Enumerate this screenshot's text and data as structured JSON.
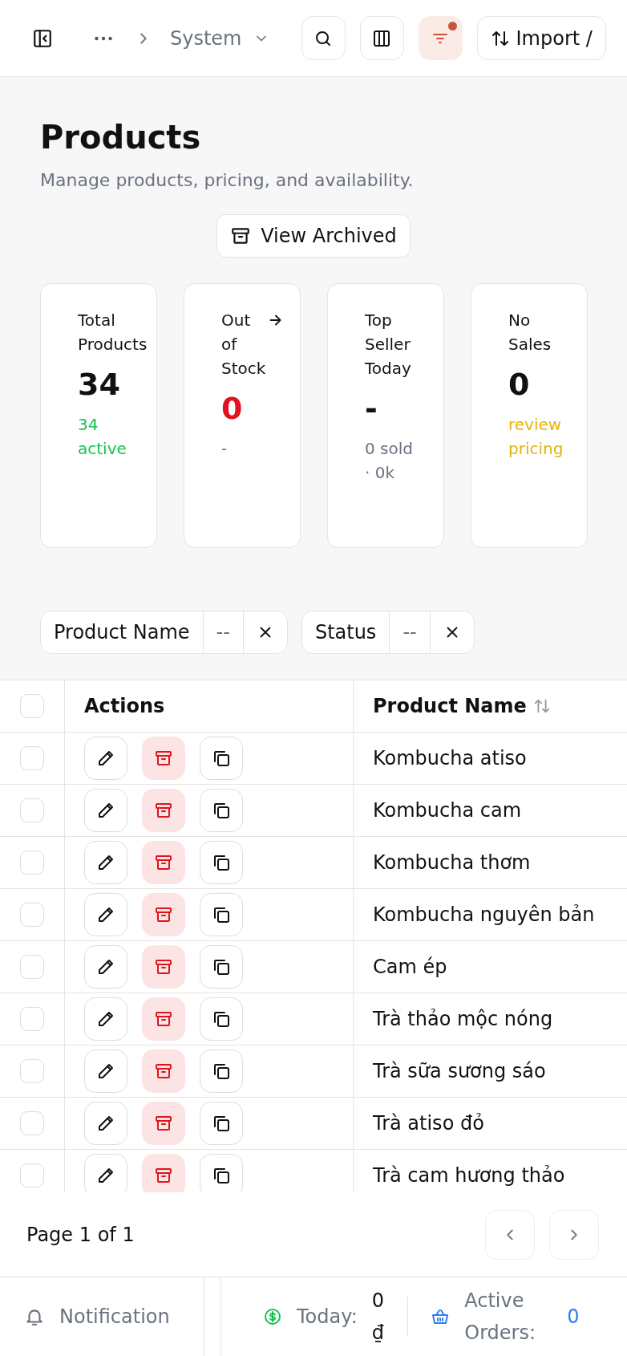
{
  "header": {
    "breadcrumb": "System",
    "filter_active": true,
    "import_label": "Import /"
  },
  "page": {
    "title": "Products",
    "subtitle": "Manage products, pricing, and availability.",
    "archived_button": "View Archived"
  },
  "stats": [
    {
      "kind": "positive",
      "label": "Total Products",
      "value": "34",
      "note": "34 active",
      "pointer": false
    },
    {
      "kind": "danger",
      "label": "Out of Stock",
      "value": "0",
      "note": "-",
      "pointer": true
    },
    {
      "kind": "neutral",
      "label": "Top Seller Today",
      "value": "-",
      "note": "0 sold · 0k",
      "pointer": false
    },
    {
      "kind": "warning",
      "label": "No Sales",
      "value": "0",
      "note": "review pricing",
      "pointer": false
    }
  ],
  "filters": [
    {
      "field": "Product Name",
      "value": "--"
    },
    {
      "field": "Status",
      "value": "--"
    }
  ],
  "table": {
    "select_all_checked": false,
    "columns": [
      "Actions",
      "Product Name"
    ],
    "rows": [
      {
        "name": "Kombucha atiso",
        "checked": false
      },
      {
        "name": "Kombucha cam",
        "checked": false
      },
      {
        "name": "Kombucha thơm",
        "checked": false
      },
      {
        "name": "Kombucha nguyên bản",
        "checked": false
      },
      {
        "name": "Cam ép",
        "checked": false
      },
      {
        "name": "Trà thảo mộc nóng",
        "checked": false
      },
      {
        "name": "Trà sữa sương sáo",
        "checked": false
      },
      {
        "name": "Trà atiso đỏ",
        "checked": false
      },
      {
        "name": "Trà cam hương thảo",
        "checked": false
      }
    ]
  },
  "pagination": {
    "label": "Page 1 of 1"
  },
  "status_bar": {
    "notification": "Notification",
    "today_label": "Today:",
    "today_value": "0 ₫",
    "orders_label": "Active Orders:",
    "orders_value": "0"
  }
}
